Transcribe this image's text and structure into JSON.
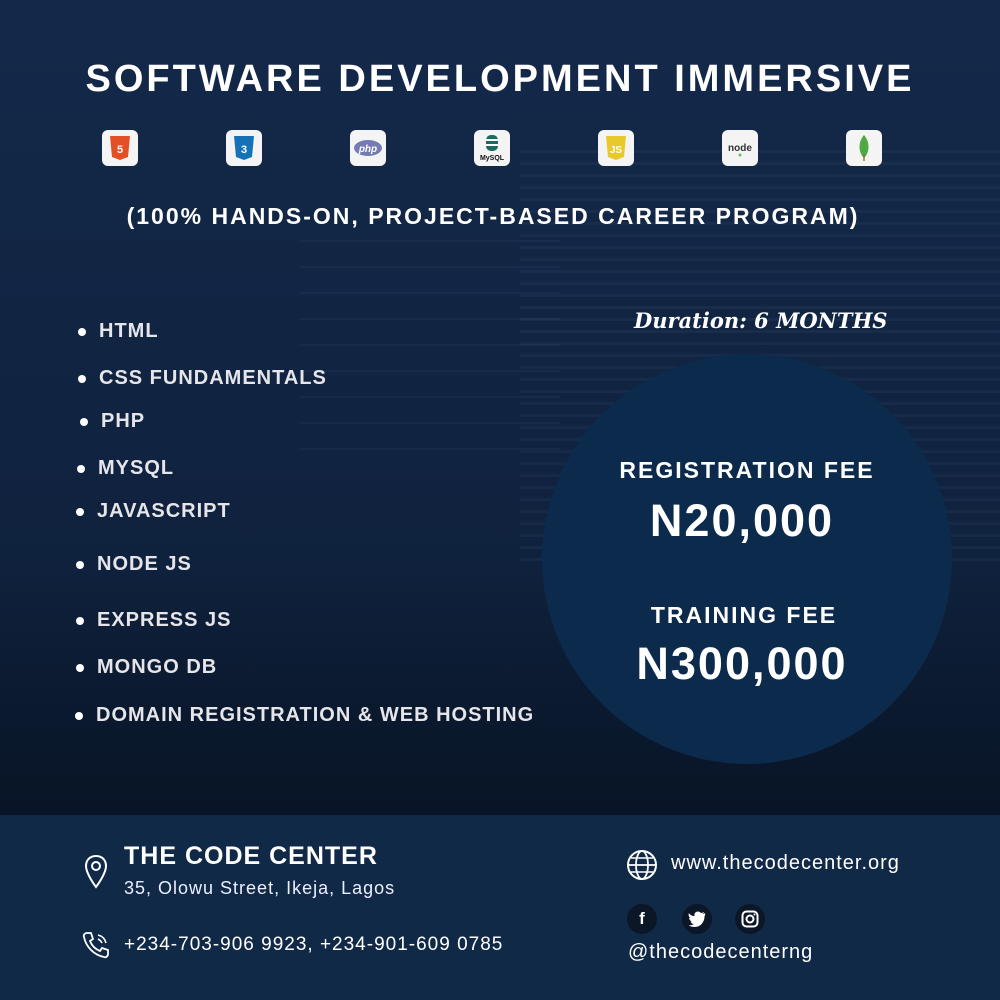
{
  "title": "SOFTWARE DEVELOPMENT IMMERSIVE",
  "subtitle": "(100% HANDS-ON, PROJECT-BASED CAREER PROGRAM)",
  "tech_icons": [
    {
      "name": "html5-icon",
      "label": "5",
      "color": "#e34f26"
    },
    {
      "name": "css3-icon",
      "label": "3",
      "color": "#1572b6"
    },
    {
      "name": "php-icon",
      "label": "php",
      "color": "#777bb4"
    },
    {
      "name": "mysql-icon",
      "label": "MySQL",
      "color": "#00546b"
    },
    {
      "name": "javascript-icon",
      "label": "JS",
      "color": "#e8c92b"
    },
    {
      "name": "nodejs-icon",
      "label": "node",
      "color": "#4b4b4b"
    },
    {
      "name": "mongodb-icon",
      "label": "",
      "color": "#4faa41"
    }
  ],
  "courses": [
    "HTML",
    "CSS FUNDAMENTALS",
    "PHP",
    "MYSQL",
    "JAVASCRIPT",
    "NODE JS",
    "EXPRESS JS",
    "MONGO DB",
    "DOMAIN REGISTRATION & WEB HOSTING"
  ],
  "duration": "Duration: 6 MONTHS",
  "fees": {
    "registration_label": "REGISTRATION FEE",
    "registration_value": "N20,000",
    "training_label": "TRAINING FEE",
    "training_value": "N300,000"
  },
  "footer": {
    "org_name": "THE CODE CENTER",
    "address": "35, Olowu Street, Ikeja, Lagos",
    "phones": "+234-703-906 9923, +234-901-609 0785",
    "website": "www.thecodecenter.org",
    "handle": "@thecodecenterng"
  },
  "colors": {
    "background": "#102340",
    "circle": "#0c2a4c",
    "footer": "#102947"
  }
}
